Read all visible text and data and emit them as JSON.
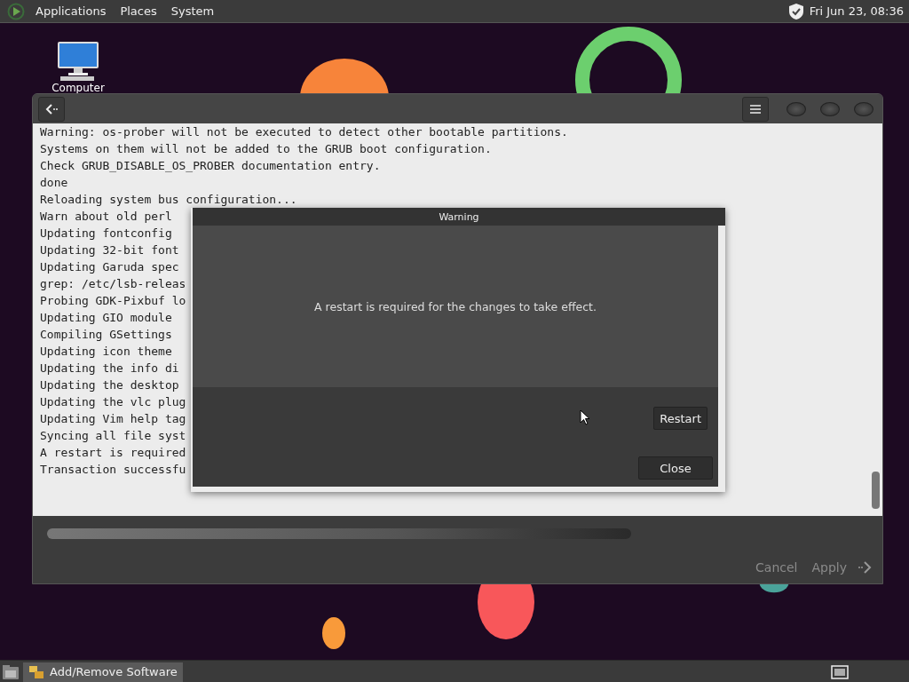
{
  "top_panel": {
    "menus": [
      "Applications",
      "Places",
      "System"
    ],
    "clock": "Fri Jun 23, 08:36"
  },
  "desktop_icons": [
    {
      "label": "Computer"
    }
  ],
  "window": {
    "log_lines": [
      "Warning: os-prober will not be executed to detect other bootable partitions.",
      "Systems on them will not be added to the GRUB boot configuration.",
      "Check GRUB_DISABLE_OS_PROBER documentation entry.",
      "done",
      "Reloading system bus configuration...",
      "Warn about old perl",
      "Updating fontconfig",
      "Updating 32-bit font",
      "Updating Garuda spec",
      "grep: /etc/lsb-releas",
      "Probing GDK-Pixbuf lo",
      "Updating GIO module",
      "Compiling GSettings",
      "Updating icon theme",
      "Updating the info di",
      "Updating the desktop",
      "Updating the vlc plug",
      "Updating Vim help tag",
      "Syncing all file syst",
      "A restart is required",
      "Transaction successfu"
    ],
    "footer_buttons": [
      {
        "label": "Cancel",
        "disabled": true
      },
      {
        "label": "Apply",
        "disabled": true
      }
    ]
  },
  "dialog": {
    "title": "Warning",
    "message": "A restart is required for the changes to take effect.",
    "buttons": [
      "Restart",
      "Close"
    ]
  },
  "taskbar": {
    "tasks": [
      {
        "label": "Add/Remove Software",
        "selected": true
      }
    ]
  }
}
